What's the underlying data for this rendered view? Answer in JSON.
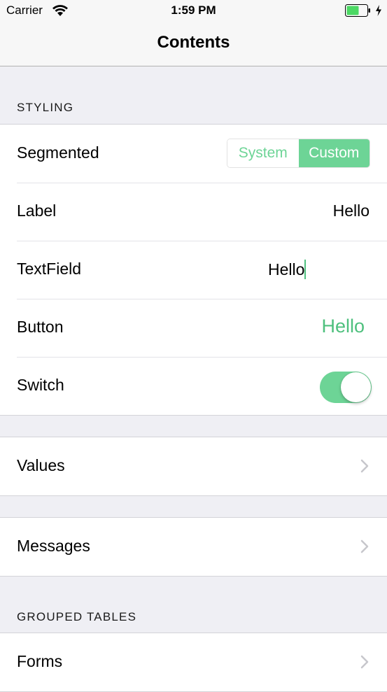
{
  "status_bar": {
    "carrier": "Carrier",
    "time": "1:59 PM",
    "wifi_icon": "wifi-icon",
    "battery_icon": "battery-charging-icon"
  },
  "nav": {
    "title": "Contents"
  },
  "sections": {
    "styling": {
      "header": "STYLING",
      "segmented": {
        "label": "Segmented",
        "options": [
          "System",
          "Custom"
        ],
        "selected": "Custom"
      },
      "label_row": {
        "label": "Label",
        "value": "Hello"
      },
      "textfield_row": {
        "label": "TextField",
        "value": "Hello"
      },
      "button_row": {
        "label": "Button",
        "button_label": "Hello"
      },
      "switch_row": {
        "label": "Switch",
        "on": true
      }
    },
    "values": {
      "label": "Values"
    },
    "messages": {
      "label": "Messages"
    },
    "grouped_tables": {
      "header": "GROUPED TABLES",
      "forms": {
        "label": "Forms"
      }
    }
  },
  "colors": {
    "accent": "#6dd496",
    "accent_text": "#4fc07e",
    "background": "#efeff4"
  }
}
